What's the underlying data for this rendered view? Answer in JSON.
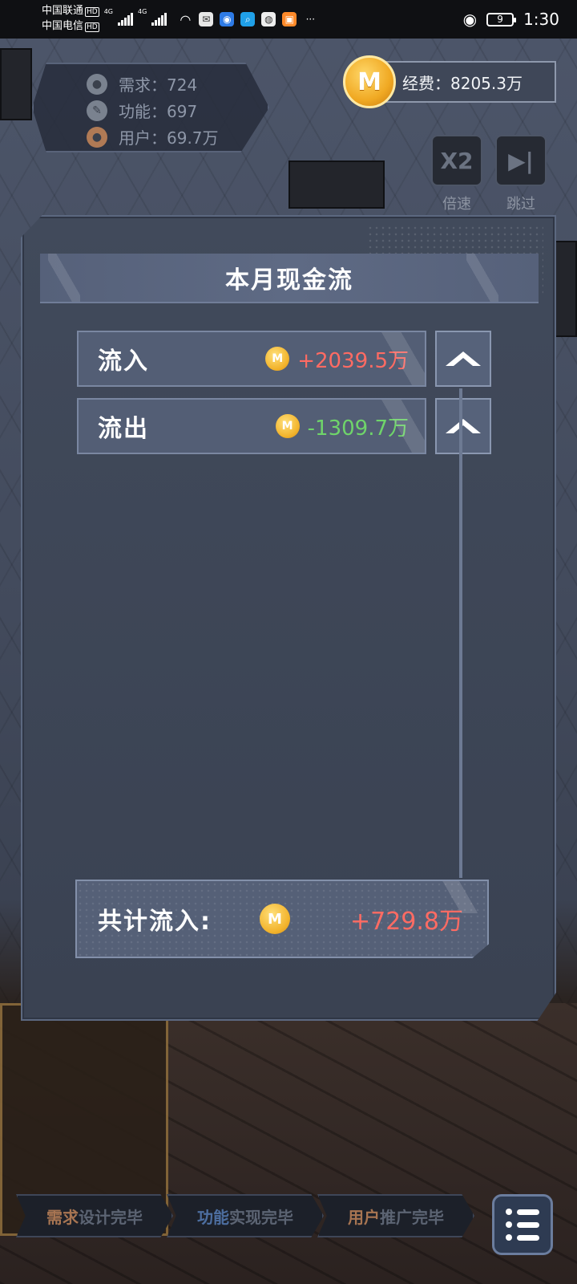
{
  "status_bar": {
    "carrier1": "中国联通",
    "carrier2": "中国电信",
    "hd": "HD",
    "network": "4G",
    "battery": "9",
    "time": "1:30"
  },
  "stats": {
    "demand": "需求：724",
    "function": "功能：697",
    "users": "用户：69.7万"
  },
  "funds": {
    "label": "经费：8205.3万"
  },
  "controls": {
    "speed_glyph": "X2",
    "speed_label": "倍速",
    "skip_label": "跳过"
  },
  "panel": {
    "title": "本月现金流",
    "inflow_label": "流入",
    "inflow_value": "+2039.5万",
    "outflow_label": "流出",
    "outflow_value": "-1309.7万",
    "total_label": "共计流入:",
    "total_value": "+729.8万"
  },
  "steps": [
    {
      "highlight": "需求",
      "rest": "设计完毕"
    },
    {
      "highlight": "功能",
      "rest": "实现完毕"
    },
    {
      "highlight": "用户",
      "rest": "推广完毕"
    }
  ],
  "colors": {
    "positive": "#ff6b63",
    "negative": "#6fd46a",
    "coin": "#f2b32c",
    "panel": "#3e4656"
  }
}
